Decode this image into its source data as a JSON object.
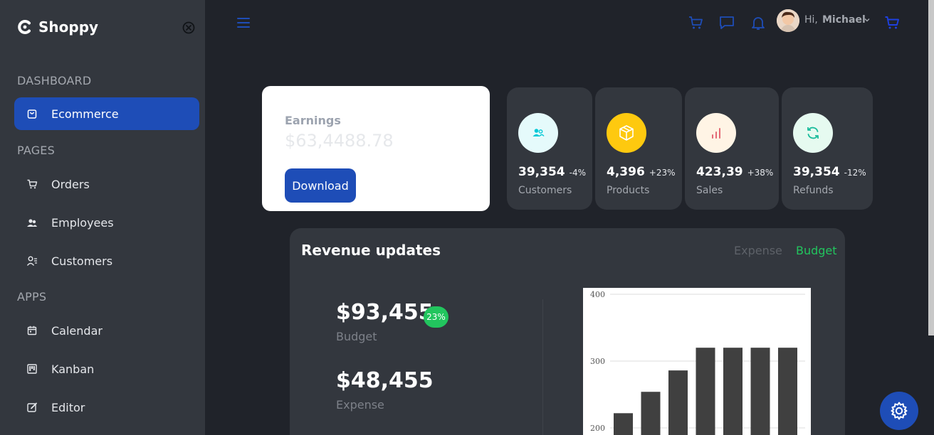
{
  "sidebar": {
    "brand": "Shoppy",
    "sections": {
      "dashboard": "DASHBOARD",
      "pages": "PAGES",
      "apps": "APPS"
    },
    "items": [
      {
        "label": "Ecommerce",
        "icon": "bag-icon",
        "active": true
      },
      {
        "label": "Orders",
        "icon": "cart-icon"
      },
      {
        "label": "Employees",
        "icon": "employees-icon"
      },
      {
        "label": "Customers",
        "icon": "customers-icon"
      },
      {
        "label": "Calendar",
        "icon": "calendar-icon"
      },
      {
        "label": "Kanban",
        "icon": "kanban-icon"
      },
      {
        "label": "Editor",
        "icon": "edit-icon"
      }
    ]
  },
  "header": {
    "greeting": "Hi,",
    "user_name": "Michael"
  },
  "earnings": {
    "label": "Earnings",
    "value": "$63,4488.78",
    "button": "Download"
  },
  "stats": [
    {
      "value": "39,354",
      "percent": "-4%",
      "label": "Customers",
      "icon": "customers-icon",
      "circle_color": "#e5fafb",
      "icon_color": "#03c9d7"
    },
    {
      "value": "4,396",
      "percent": "+23%",
      "label": "Products",
      "icon": "box-icon",
      "circle_color": "#fec90f",
      "icon_color": "#ffffff"
    },
    {
      "value": "423,39",
      "percent": "+38%",
      "label": "Sales",
      "icon": "bar-chart-icon",
      "circle_color": "#fff4e5",
      "icon_color": "#e46a76"
    },
    {
      "value": "39,354",
      "percent": "-12%",
      "label": "Refunds",
      "icon": "refresh-icon",
      "circle_color": "#e6faf0",
      "icon_color": "#1abc9c"
    }
  ],
  "revenue": {
    "title": "Revenue updates",
    "legend_expense": "Expense",
    "legend_budget": "Budget",
    "budget_value": "$93,455",
    "budget_badge": "23%",
    "budget_label": "Budget",
    "expense_value": "$48,455",
    "expense_label": "Expense"
  },
  "colors": {
    "accent": "#1e4db7",
    "success": "#22c55e"
  },
  "chart_data": {
    "type": "bar",
    "yticks": [
      200,
      300,
      400
    ],
    "ylim": [
      150,
      400
    ],
    "values": [
      222,
      254,
      286,
      320,
      320,
      320,
      320
    ]
  }
}
